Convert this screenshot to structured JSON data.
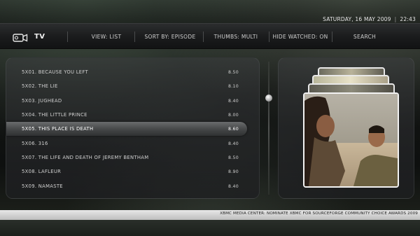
{
  "header": {
    "section_title": "TV",
    "section_icon": "tv-camera-icon",
    "date": "SATURDAY, 16 MAY 2009",
    "separator": "|",
    "time": "22:43",
    "menu": [
      {
        "label": "VIEW: LIST"
      },
      {
        "label": "SORT BY: EPISODE"
      },
      {
        "label": "THUMBS: MULTI"
      },
      {
        "label": "HIDE WATCHED: ON"
      },
      {
        "label": "SEARCH"
      }
    ]
  },
  "episodes": [
    {
      "title": "5X01. BECAUSE YOU LEFT",
      "rating": "8.50"
    },
    {
      "title": "5X02. THE LIE",
      "rating": "8.10"
    },
    {
      "title": "5X03. JUGHEAD",
      "rating": "8.40"
    },
    {
      "title": "5X04. THE LITTLE PRINCE",
      "rating": "8.00"
    },
    {
      "title": "5X05. THIS PLACE IS DEATH",
      "rating": "8.60",
      "selected": true
    },
    {
      "title": "5X06. 316",
      "rating": "8.40"
    },
    {
      "title": "5X07. THE LIFE AND DEATH OF JEREMY BENTHAM",
      "rating": "8.50"
    },
    {
      "title": "5X08. LAFLEUR",
      "rating": "8.90"
    },
    {
      "title": "5X09. NAMASTE",
      "rating": "8.40"
    }
  ],
  "footer": {
    "ticker": "XBMC MEDIA CENTER: NOMINATE XBMC FOR SOURCEFORGE COMMUNITY CHOICE AWARDS 2009"
  },
  "colors": {
    "selection": "#555758",
    "panel": "#2a2b2d",
    "footer_bar": "#d9d9d9"
  }
}
